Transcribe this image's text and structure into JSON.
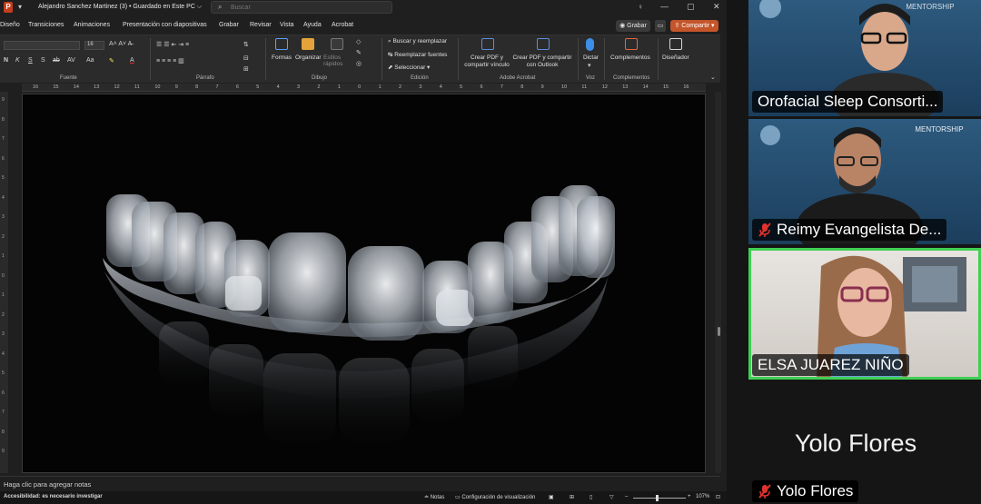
{
  "titlebar": {
    "doc_title": "Alejandro Sanchez Martinez (3) • Guardado en Este PC ⌵",
    "search_placeholder": "Buscar"
  },
  "menu": {
    "items": [
      "Diseño",
      "Transiciones",
      "Animaciones",
      "Presentación con diapositivas",
      "Grabar",
      "Revisar",
      "Vista",
      "Ayuda",
      "Acrobat"
    ],
    "grabar": "Grabar",
    "compartir": "Compartir"
  },
  "ribbon": {
    "groups": [
      "Fuente",
      "Párrafo",
      "Dibujo",
      "Edición",
      "Adobe Acrobat",
      "Voz",
      "Complementos"
    ],
    "font_size": "16",
    "draw": {
      "formas": "Formas",
      "organizar": "Organizar",
      "estilos": "Estilos rápidos"
    },
    "edit": {
      "buscar": "Buscar y reemplazar",
      "reemplazar": "Reemplazar fuentes",
      "seleccionar": "Seleccionar"
    },
    "acrobat": {
      "pdf_link": "Crear PDF y compartir vínculo",
      "pdf_outlook": "Crear PDF y compartir con Outlook"
    },
    "dictar": "Dictar",
    "complementos": "Complementos",
    "disenador": "Diseñador"
  },
  "ruler_ticks": [
    "16",
    "15",
    "14",
    "13",
    "12",
    "11",
    "10",
    "9",
    "8",
    "7",
    "6",
    "5",
    "4",
    "3",
    "2",
    "1",
    "0",
    "1",
    "2",
    "3",
    "4",
    "5",
    "6",
    "7",
    "8",
    "9",
    "10",
    "11",
    "12",
    "13",
    "14",
    "15",
    "16"
  ],
  "notes_placeholder": "Haga clic para agregar notas",
  "status": {
    "accessibility": "Accesibilidad: es necesario investigar",
    "notas": "Notas",
    "config": "Configuración de visualización",
    "zoom": "107%"
  },
  "participants": [
    {
      "name": "Orofacial Sleep Consorti...",
      "muted": false,
      "active": false,
      "banner": "MENTORSHIP"
    },
    {
      "name": "Reimy Evangelista De...",
      "muted": true,
      "active": false,
      "banner": "MENTORSHIP"
    },
    {
      "name": "ELSA JUAREZ NIÑO",
      "muted": false,
      "active": true,
      "banner": ""
    }
  ],
  "camera_off_participant": {
    "display_name": "Yolo Flores",
    "tag": "Yolo Flores",
    "muted": true
  },
  "colors": {
    "active_border": "#3fcf52",
    "share_button": "#c4552a",
    "tile_bg": "#1e3b57",
    "mic_off": "#e0322f"
  }
}
